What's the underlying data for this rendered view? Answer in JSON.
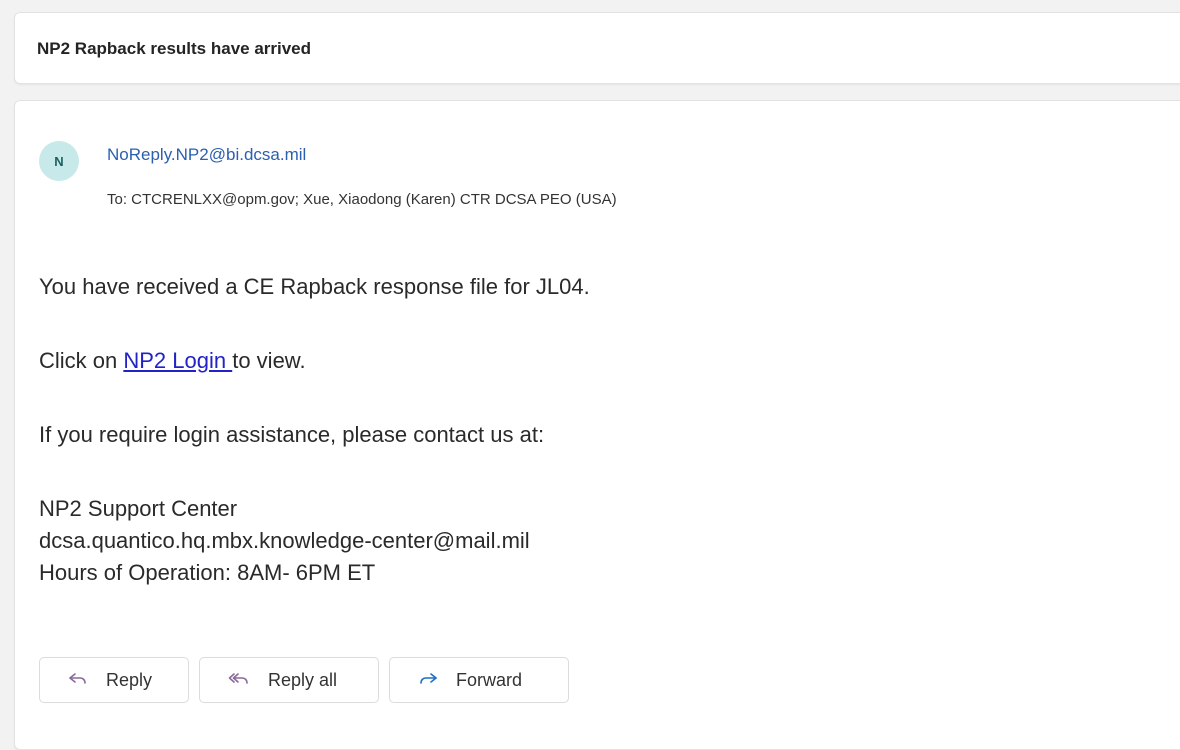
{
  "subject": "NP2 Rapback results have arrived",
  "message": {
    "avatar_initial": "N",
    "sender": "NoReply.NP2@bi.dcsa.mil",
    "recipients": "To:  CTCRENLXX@opm.gov;  Xue, Xiaodong (Karen) CTR DCSA PEO (USA)",
    "body": {
      "line1": "You have received a CE Rapback response file for JL04.",
      "line2_prefix": "Click on ",
      "line2_link": "NP2 Login ",
      "line2_suffix": "to view.",
      "line3": "If you require login assistance, please contact us at:",
      "support_name": "NP2 Support Center",
      "support_email": "dcsa.quantico.hq.mbx.knowledge-center@mail.mil",
      "support_hours": "Hours of Operation: 8AM- 6PM ET"
    }
  },
  "actions": {
    "reply": "Reply",
    "reply_all": "Reply all",
    "forward": "Forward"
  },
  "icons": {
    "reply": "reply-arrow-icon",
    "reply_all": "reply-all-arrow-icon",
    "forward": "forward-arrow-icon"
  },
  "colors": {
    "sender_link": "#2b5fb0",
    "body_link": "#2222c8",
    "avatar_bg": "#c7e9ea"
  }
}
